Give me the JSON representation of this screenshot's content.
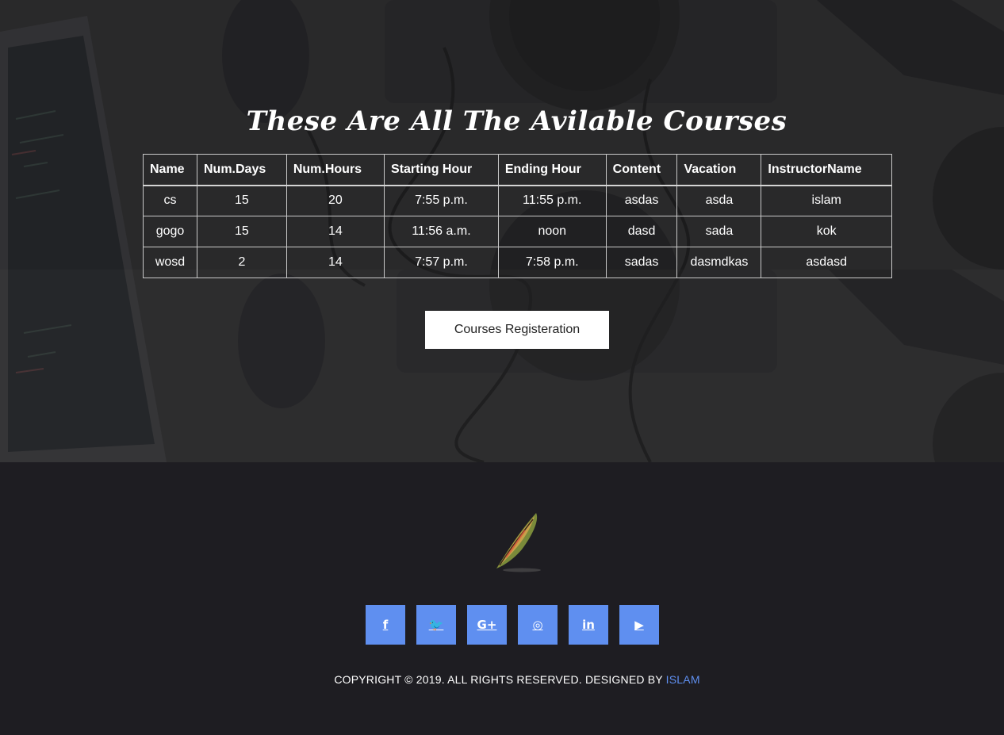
{
  "hero": {
    "title": "These Are All The Avilable Courses",
    "register_button": "Courses Registeration"
  },
  "table": {
    "headers": [
      "Name",
      "Num.Days",
      "Num.Hours",
      "Starting Hour",
      "Ending Hour",
      "Content",
      "Vacation",
      "InstructorName"
    ],
    "rows": [
      [
        "cs",
        "15",
        "20",
        "7:55 p.m.",
        "11:55 p.m.",
        "asdas",
        "asda",
        "islam"
      ],
      [
        "gogo",
        "15",
        "14",
        "11:56 a.m.",
        "noon",
        "dasd",
        "sada",
        "kok"
      ],
      [
        "wosd",
        "2",
        "14",
        "7:57 p.m.",
        "7:58 p.m.",
        "sadas",
        "dasmdkas",
        "asdasd"
      ]
    ]
  },
  "footer": {
    "logo_icon": "quill-feather-icon",
    "socials": [
      {
        "name": "facebook-icon",
        "glyph": "f"
      },
      {
        "name": "twitter-icon",
        "glyph": "🐦"
      },
      {
        "name": "google-plus-icon",
        "glyph": "G+"
      },
      {
        "name": "instagram-icon",
        "glyph": "◎"
      },
      {
        "name": "linkedin-icon",
        "glyph": "in"
      },
      {
        "name": "youtube-icon",
        "glyph": "▶"
      }
    ],
    "copyright_text": "COPYRIGHT © 2019. ALL RIGHTS RESERVED. DESIGNED BY",
    "designer_link": "ISLAM"
  },
  "colors": {
    "accent": "#5f8ff0",
    "footer_bg": "#1e1d22",
    "hero_bg": "#2b2a2b"
  }
}
